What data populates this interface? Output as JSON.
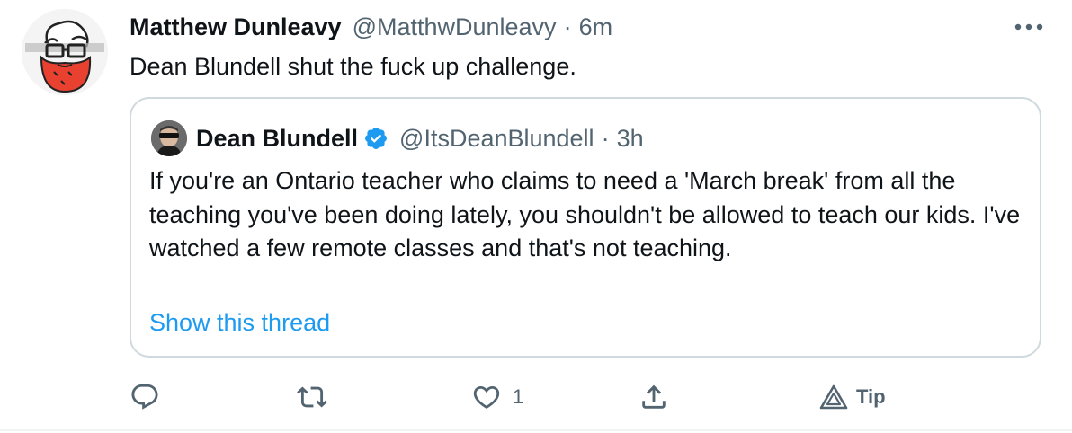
{
  "tweet": {
    "author_name": "Matthew Dunleavy",
    "author_handle": "@MatthwDunleavy",
    "separator": "·",
    "time": "6m",
    "text": "Dean Blundell shut the fuck up challenge."
  },
  "quoted_tweet": {
    "author_name": "Dean Blundell",
    "verified": true,
    "author_handle": "@ItsDeanBlundell",
    "separator": "·",
    "time": "3h",
    "text": "If you're an Ontario teacher who claims to need a 'March break' from all the teaching you've been doing lately, you shouldn't be allowed to teach our kids.  I've watched a few remote classes and that's not teaching.",
    "show_thread_label": "Show this thread"
  },
  "actions": {
    "reply_icon": "reply-icon",
    "retweet_icon": "retweet-icon",
    "like_icon": "heart-icon",
    "like_count": "1",
    "share_icon": "share-icon",
    "tip_icon": "tip-icon",
    "tip_label": "Tip"
  },
  "colors": {
    "link": "#1d9bf0",
    "secondary_text": "#536471",
    "border": "#cfd9de",
    "verified": "#1d9bf0",
    "avatar_red": "#e8412f"
  }
}
